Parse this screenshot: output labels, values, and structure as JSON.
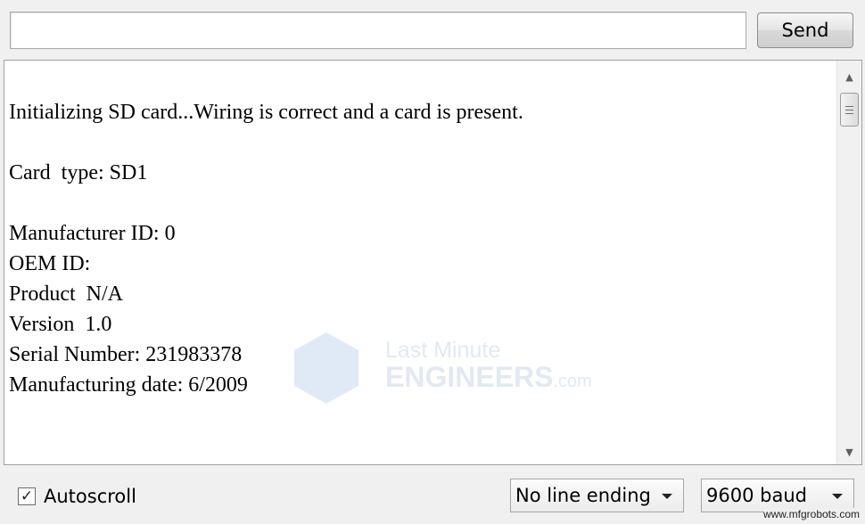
{
  "input": {
    "value": "",
    "placeholder": ""
  },
  "send_button": {
    "label": "Send"
  },
  "output": {
    "lines": [
      "Initializing SD card...Wiring is correct and a card is present.",
      "Card  type: SD1",
      "Manufacturer ID: 0",
      "OEM ID:",
      "Product  N/A",
      "Version  1.0",
      "Serial Number: 231983378",
      "Manufacturing date: 6/2009"
    ]
  },
  "watermark": {
    "line1": "Last Minute",
    "line2": "ENGINEERS",
    "line3": ".com"
  },
  "autoscroll": {
    "label": "Autoscroll",
    "checked": true
  },
  "line_ending": {
    "selected": "No line ending"
  },
  "baud_rate": {
    "selected": "9600 baud"
  },
  "footer_credit": "www.mfgrobots.com"
}
